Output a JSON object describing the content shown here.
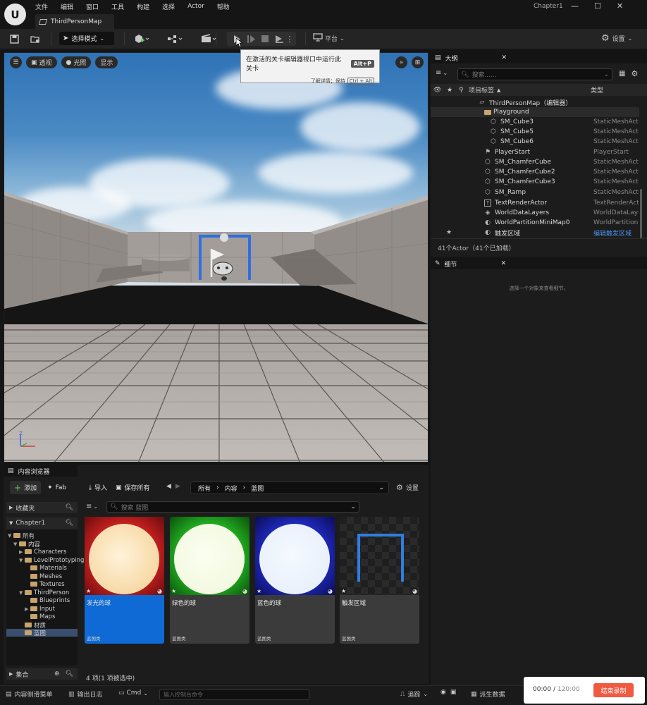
{
  "app": {
    "logo": "U",
    "menu": [
      "文件",
      "编辑",
      "窗口",
      "工具",
      "构建",
      "选择",
      "Actor",
      "帮助"
    ],
    "map_tab": "ThirdPersonMap",
    "project_name": "Chapter1",
    "window_controls": [
      "—",
      "☐",
      "✕"
    ]
  },
  "toolbar": {
    "mode_label": "选择模式",
    "platform_label": "平台",
    "settings_label": "设置"
  },
  "viewport": {
    "perspective": "透视",
    "lighting": "光照",
    "show": "显示"
  },
  "tooltip": {
    "text": "在激活的关卡编辑器视口中运行此关卡",
    "shortcut": "Alt+P",
    "more": "了解详情；保持",
    "more_key": "Ctrl + Alt"
  },
  "outliner": {
    "tab": "大纲",
    "search_placeholder": "搜索......",
    "col_label": "项目标签",
    "col_type": "类型",
    "rows": [
      {
        "name": "ThirdPersonMap（编辑器）",
        "type": ""
      },
      {
        "name": "Playground",
        "type": ""
      },
      {
        "name": "SM_Cube3",
        "type": "StaticMeshActor"
      },
      {
        "name": "SM_Cube5",
        "type": "StaticMeshActor"
      },
      {
        "name": "SM_Cube6",
        "type": "StaticMeshActor"
      },
      {
        "name": "PlayerStart",
        "type": "PlayerStart"
      },
      {
        "name": "SM_ChamferCube",
        "type": "StaticMeshActor"
      },
      {
        "name": "SM_ChamferCube2",
        "type": "StaticMeshActor"
      },
      {
        "name": "SM_ChamferCube3",
        "type": "StaticMeshActor"
      },
      {
        "name": "SM_Ramp",
        "type": "StaticMeshActor"
      },
      {
        "name": "TextRenderActor",
        "type": "TextRenderActor"
      },
      {
        "name": "WorldDataLayers",
        "type": "WorldDataLayers"
      },
      {
        "name": "WorldPartitionMiniMap0",
        "type": "WorldPartitionMiniMap"
      },
      {
        "name": "触发区域",
        "type": "编辑触发区域"
      }
    ],
    "footer": "41个Actor（41个已加载）"
  },
  "details": {
    "tab": "细节",
    "empty_text": "选择一个对象来查看细节。"
  },
  "content_browser": {
    "tab": "内容浏览器",
    "add": "添加",
    "fab": "Fab",
    "import": "导入",
    "save_all": "保存所有",
    "breadcrumb": [
      "所有",
      "内容",
      "蓝图"
    ],
    "settings": "设置",
    "favorites": "收藏夹",
    "project": "Chapter1",
    "search_placeholder": "搜索 蓝图",
    "tree": [
      "所有",
      "内容",
      "Characters",
      "LevelPrototyping",
      "Materials",
      "Meshes",
      "Textures",
      "ThirdPerson",
      "Blueprints",
      "Input",
      "Maps",
      "材质",
      "蓝图"
    ],
    "collections": "集合",
    "assets": [
      {
        "name": "发光的球",
        "kind": "蓝图类"
      },
      {
        "name": "绿色的球",
        "kind": "蓝图类"
      },
      {
        "name": "蓝色的球",
        "kind": "蓝图类"
      },
      {
        "name": "触发区域",
        "kind": "蓝图类"
      }
    ],
    "status": "4 项(1 项被选中)"
  },
  "statusbar": {
    "drawer": "内容侧滑菜单",
    "output_log": "输出日志",
    "cmd": "Cmd",
    "cmd_placeholder": "输入控制台命令",
    "trace": "追踪",
    "derived_data": "派生数据"
  },
  "recorder": {
    "elapsed": "00:00",
    "separator": "/",
    "limit": "120:00",
    "stop": "结束录制"
  }
}
